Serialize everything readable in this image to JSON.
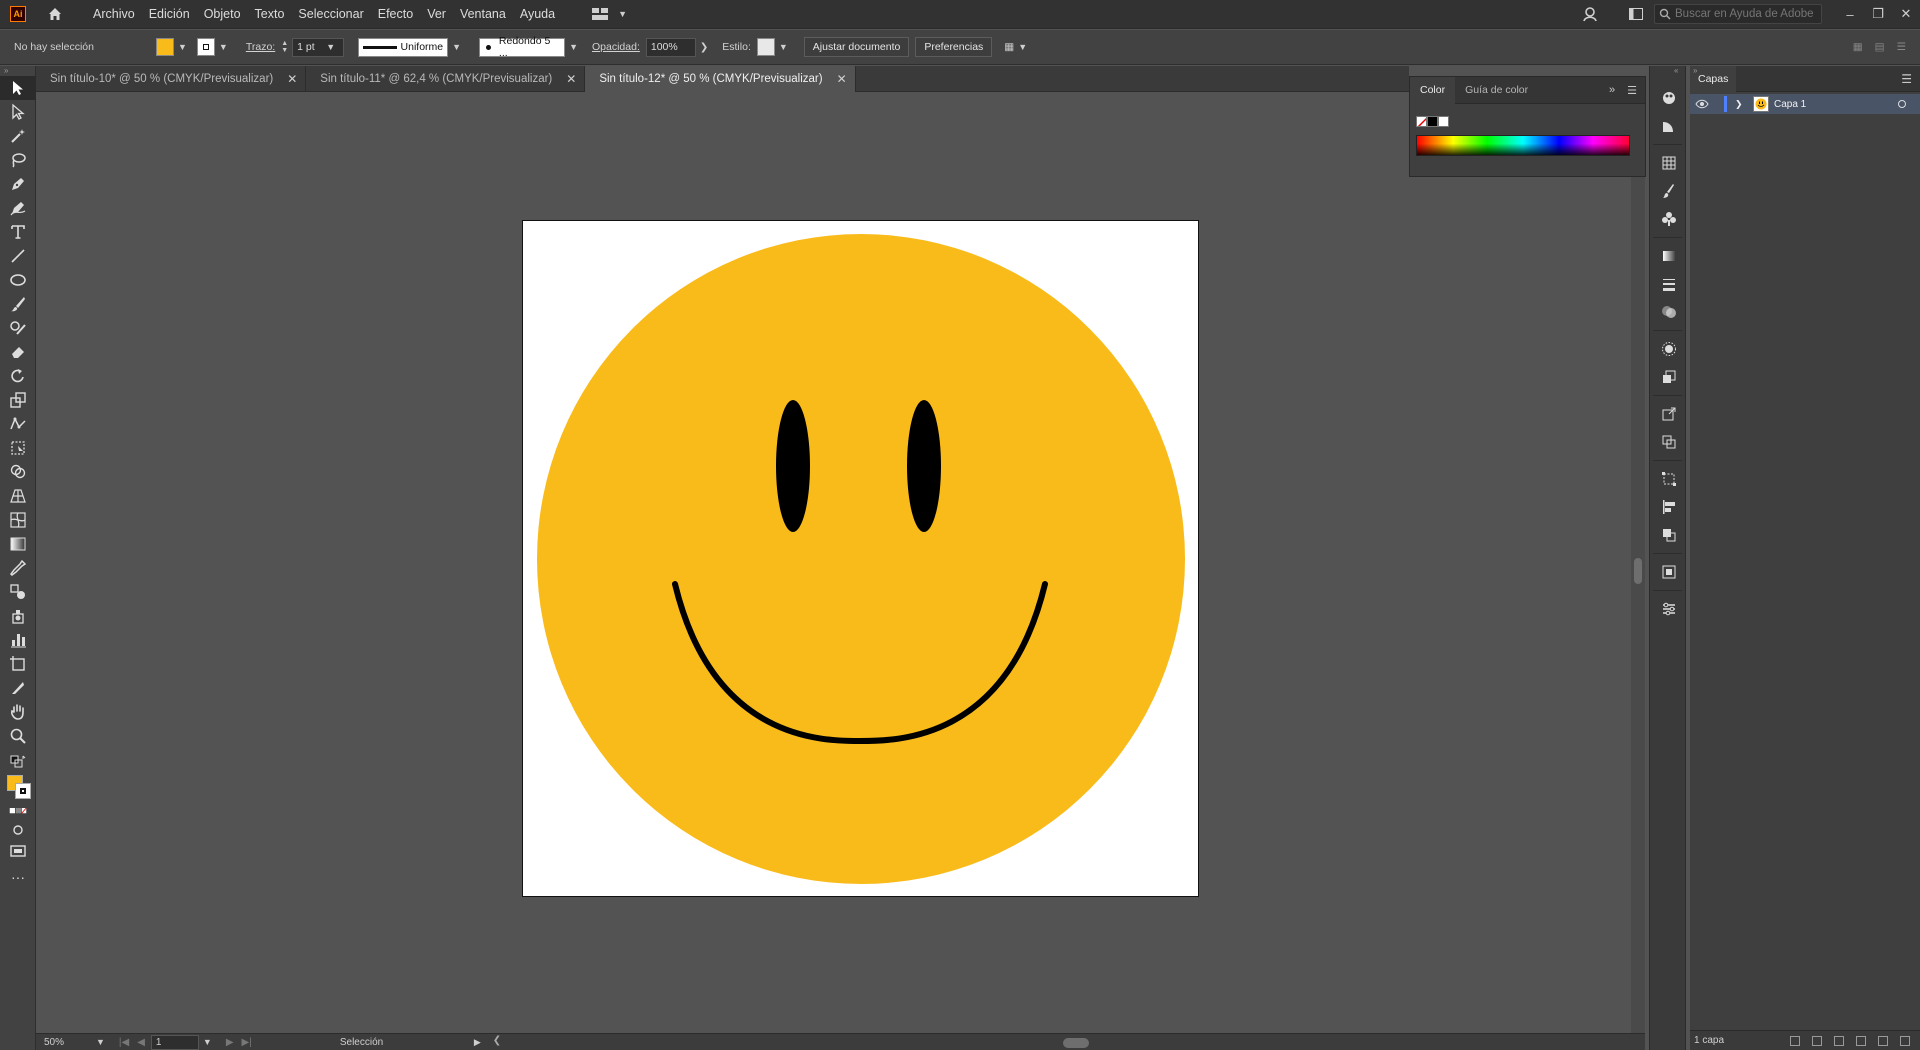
{
  "app": {
    "logo": "Ai"
  },
  "menu": [
    "Archivo",
    "Edición",
    "Objeto",
    "Texto",
    "Seleccionar",
    "Efecto",
    "Ver",
    "Ventana",
    "Ayuda"
  ],
  "help_search": {
    "placeholder": "Buscar en Ayuda de Adobe"
  },
  "control_bar": {
    "selection_status": "No hay selección",
    "fill_color": "#F9BB1A",
    "stroke_label": "Trazo:",
    "stroke_weight": "1 pt",
    "stroke_profile": "Uniforme",
    "brush": "Redondo 5 ...",
    "opacity_label": "Opacidad:",
    "opacity_value": "100%",
    "style_label": "Estilo:",
    "fit_document_button": "Ajustar documento",
    "preferences_button": "Preferencias"
  },
  "tabs": [
    {
      "label": "Sin título-10* @ 50 % (CMYK/Previsualizar)",
      "active": false
    },
    {
      "label": "Sin título-11* @ 62,4 % (CMYK/Previsualizar)",
      "active": false
    },
    {
      "label": "Sin título-12* @ 50 % (CMYK/Previsualizar)",
      "active": true
    }
  ],
  "tools": [
    "selection-tool",
    "direct-selection-tool",
    "magic-wand-tool",
    "lasso-tool",
    "pen-tool",
    "curvature-tool",
    "type-tool",
    "line-segment-tool",
    "ellipse-tool",
    "paintbrush-tool",
    "shaper-tool",
    "eraser-tool",
    "rotate-tool",
    "scale-tool",
    "puppet-warp-tool",
    "free-transform-tool",
    "shape-builder-tool",
    "perspective-grid-tool",
    "mesh-tool",
    "gradient-tool",
    "eyedropper-tool",
    "blend-tool",
    "symbol-sprayer-tool",
    "column-graph-tool",
    "artboard-tool",
    "slice-tool",
    "hand-tool",
    "zoom-tool"
  ],
  "color_panel": {
    "tabs": [
      "Color",
      "Guía de color"
    ]
  },
  "artwork": {
    "face_color": "#F9BB1A",
    "feature_color": "#000000",
    "background": "#FFFFFF"
  },
  "layers_panel": {
    "title": "Capas",
    "layers": [
      {
        "name": "Capa 1",
        "color": "#4F80FF"
      }
    ],
    "count_label": "1 capa"
  },
  "status_bar": {
    "zoom": "50%",
    "page": "1",
    "current_tool": "Selección"
  }
}
